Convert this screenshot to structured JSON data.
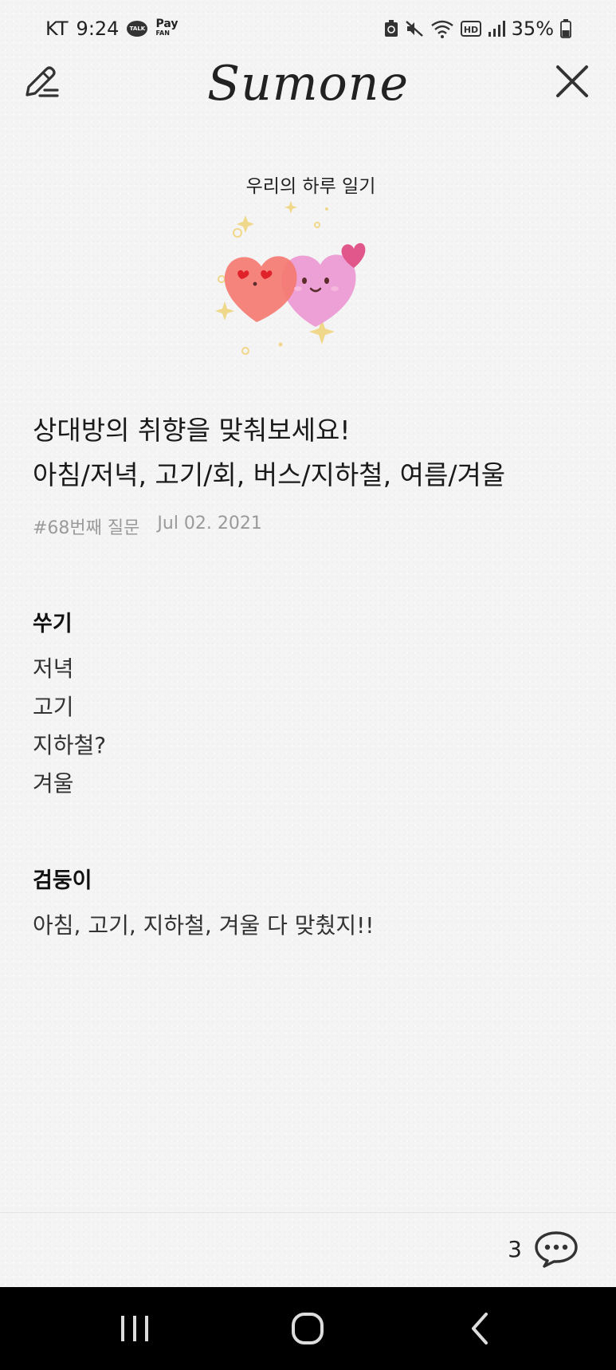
{
  "status_bar": {
    "carrier": "KT",
    "time": "9:24",
    "talk_badge": "TALK",
    "pay_badge_top": "Pay",
    "pay_badge_bottom": "FAN",
    "hd_badge": "HD",
    "battery": "35%"
  },
  "header": {
    "title": "Sumone",
    "edit_icon": "pencil-edit-icon",
    "close_icon": "close-icon"
  },
  "illustration": {
    "caption": "우리의 하루 일기",
    "hearts": [
      "heart-eyes-heart",
      "smiling-pink-heart",
      "small-heart"
    ],
    "colors": {
      "left_heart": "#f47a72",
      "right_heart": "#ec9bd3",
      "small_heart": "#e2578b",
      "sparkle": "#f0d88a"
    }
  },
  "question": {
    "line1": "상대방의 취향을 맞춰보세요!",
    "line2": "아침/저녁, 고기/회, 버스/지하철, 여름/겨울",
    "number": "#68번째 질문",
    "date": "Jul 02. 2021"
  },
  "answers": [
    {
      "name": "쑤기",
      "lines": [
        "저녁",
        "고기",
        "지하철?",
        "겨울"
      ]
    },
    {
      "name": "검둥이",
      "lines": [
        "아침, 고기, 지하철, 겨울 다 맞췄지!!"
      ]
    }
  ],
  "footer": {
    "comment_count": "3",
    "comment_icon": "chat-bubble-icon"
  },
  "nav_bar": {
    "recent_icon": "recent-apps-icon",
    "home_icon": "home-icon",
    "back_icon": "back-icon"
  }
}
